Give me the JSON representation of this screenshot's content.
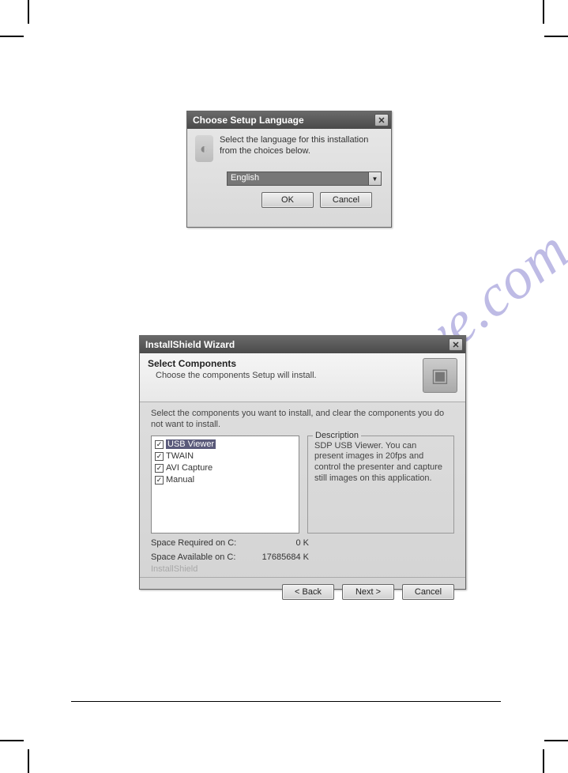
{
  "watermark": "manualshive.com",
  "dialog1": {
    "title": "Choose Setup Language",
    "message": "Select the language for this installation from the choices below.",
    "selected_language": "English",
    "ok": "OK",
    "cancel": "Cancel"
  },
  "dialog2": {
    "title": "InstallShield Wizard",
    "header_title": "Select Components",
    "header_sub": "Choose the components Setup will install.",
    "instruction": "Select the components you want to install, and clear the components you do not want to install.",
    "components": [
      {
        "label": "USB Viewer",
        "checked": true,
        "selected": true
      },
      {
        "label": "TWAIN",
        "checked": true,
        "selected": false
      },
      {
        "label": "AVI Capture",
        "checked": true,
        "selected": false
      },
      {
        "label": "Manual",
        "checked": true,
        "selected": false
      }
    ],
    "description_legend": "Description",
    "description_text": "SDP USB Viewer. You can present images in 20fps and control the presenter and capture still images on this application.",
    "space_required_label": "Space Required on  C:",
    "space_required_value": "0 K",
    "space_available_label": "Space Available on  C:",
    "space_available_value": "17685684 K",
    "brand": "InstallShield",
    "back": "< Back",
    "next": "Next >",
    "cancel": "Cancel"
  }
}
